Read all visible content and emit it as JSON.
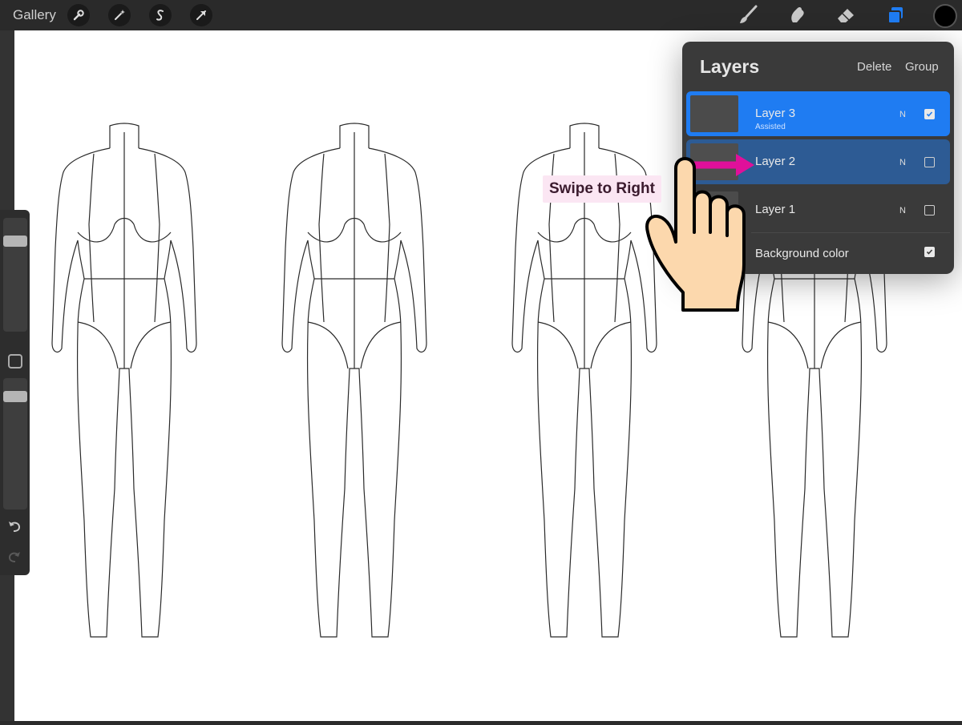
{
  "topbar": {
    "gallery_label": "Gallery",
    "left_tools": [
      "wrench-icon",
      "magic-wand-icon",
      "selection-s-icon",
      "transform-arrow-icon"
    ],
    "right_tools": [
      "brush-icon",
      "smudge-icon",
      "eraser-icon",
      "layers-icon"
    ],
    "active_tool_color": "#1f7cf2",
    "current_color": "#000000"
  },
  "layers_panel": {
    "title": "Layers",
    "delete_label": "Delete",
    "group_label": "Group",
    "layers": [
      {
        "name": "Layer 3",
        "sublabel": "Assisted",
        "mode": "N",
        "visible": true,
        "selected": true
      },
      {
        "name": "Layer 2",
        "sublabel": "",
        "mode": "N",
        "visible": false,
        "selected": false,
        "highlighted": true
      },
      {
        "name": "Layer 1",
        "sublabel": "",
        "mode": "N",
        "visible": false,
        "selected": false
      },
      {
        "name": "Background color",
        "sublabel": "",
        "mode": "",
        "visible": true,
        "selected": false
      }
    ],
    "selected_color": "#1f7cf2",
    "highlighted_color": "#2d5b94"
  },
  "annotation": {
    "callout_text": "Swipe to Right",
    "arrow_color": "#e0109a"
  },
  "sidebar": {
    "brush_size_level": 0.1,
    "opacity_level": 0.1,
    "undo_icon": "undo-icon",
    "redo_icon": "redo-icon"
  }
}
